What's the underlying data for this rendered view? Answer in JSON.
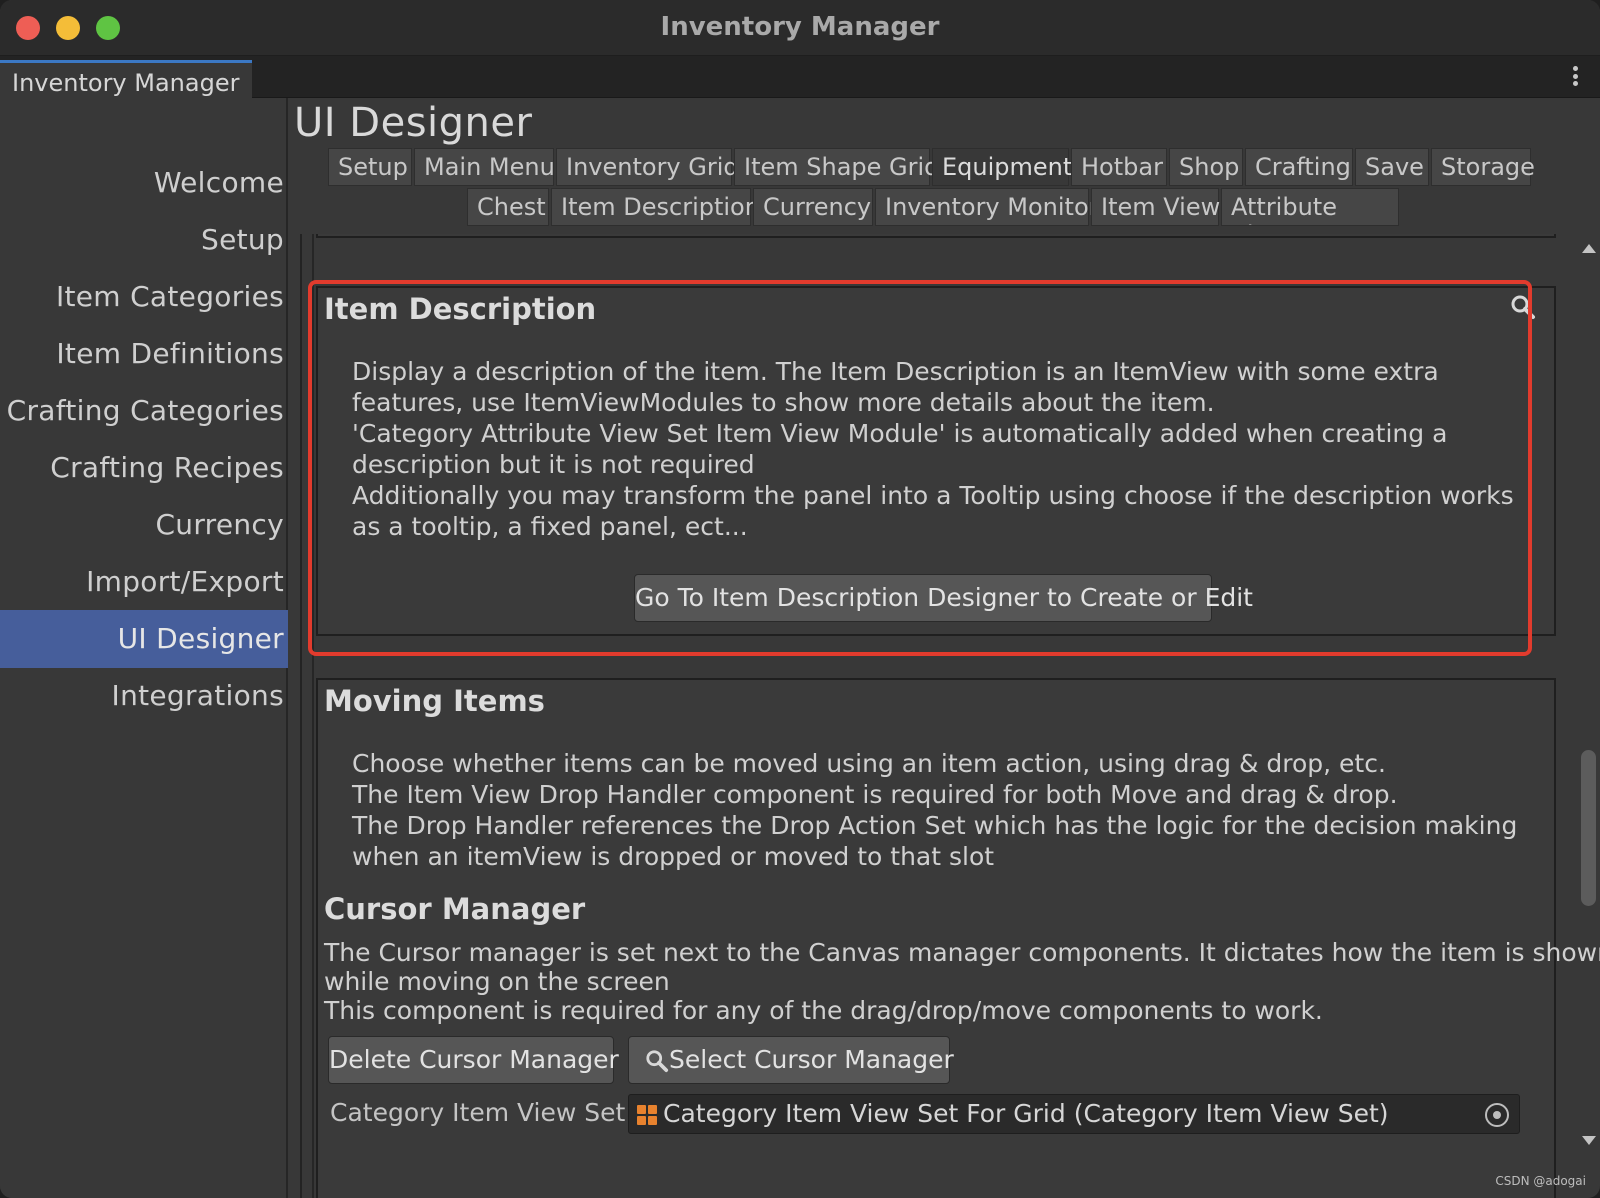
{
  "window": {
    "title": "Inventory Manager"
  },
  "editor_tab": {
    "label": "Inventory Manager"
  },
  "sidebar": {
    "items": [
      {
        "label": "Welcome"
      },
      {
        "label": "Setup"
      },
      {
        "label": "Item Categories"
      },
      {
        "label": "Item Definitions"
      },
      {
        "label": "Crafting Categories"
      },
      {
        "label": "Crafting Recipes"
      },
      {
        "label": "Currency"
      },
      {
        "label": "Import/Export"
      },
      {
        "label": "UI Designer",
        "active": true
      },
      {
        "label": "Integrations"
      }
    ]
  },
  "main": {
    "title": "UI Designer",
    "tabs_row1": [
      "Setup",
      "Main Menu",
      "Inventory Grid",
      "Item Shape Grid",
      "Equipment",
      "Hotbar",
      "Shop",
      "Crafting",
      "Save",
      "Storage"
    ],
    "selected_tab": "Equipment",
    "tabs_row2": [
      "Chest",
      "Item Description",
      "Currency",
      "Inventory Monitor",
      "Item View",
      "Attribute View"
    ]
  },
  "item_description": {
    "title": "Item Description",
    "lines": [
      "Display a description of the item. The Item Description is an ItemView with some extra",
      "features, use ItemViewModules to show more details about the item.",
      "'Category Attribute View Set Item View Module' is automatically added when creating a",
      "description but it is not required",
      "Additionally you may transform the panel into a Tooltip using choose if the description works",
      "as a tooltip, a fixed panel, ect..."
    ],
    "button_label": "Go To Item Description Designer to Create or Edit",
    "search_icon": "search-icon"
  },
  "moving_items": {
    "title": "Moving Items",
    "lines": [
      "Choose whether items can be moved using an item action, using drag & drop, etc.",
      "The Item View Drop Handler component is required for both Move and drag & drop.",
      "The Drop Handler references the Drop Action Set which has the logic for the decision making",
      "when an itemView is dropped or moved to that slot"
    ]
  },
  "cursor_manager": {
    "title": "Cursor Manager",
    "lines": [
      "The Cursor manager is set next to the Canvas manager components. It dictates how the item is shown",
      "while moving on the screen",
      "This component is required for any of the drag/drop/move components to work."
    ],
    "delete_button": "Delete Cursor Manager",
    "select_button": "Select Cursor Manager",
    "field_label": "Category Item View Set",
    "field_value": "Category Item View Set For Grid (Category Item View Set)"
  },
  "watermark": "CSDN @adogai",
  "colors": {
    "highlight": "#e23b2d",
    "active_nav": "#465e9b",
    "tab_accent": "#3b78c4",
    "asset_icon": "#e8822e"
  }
}
